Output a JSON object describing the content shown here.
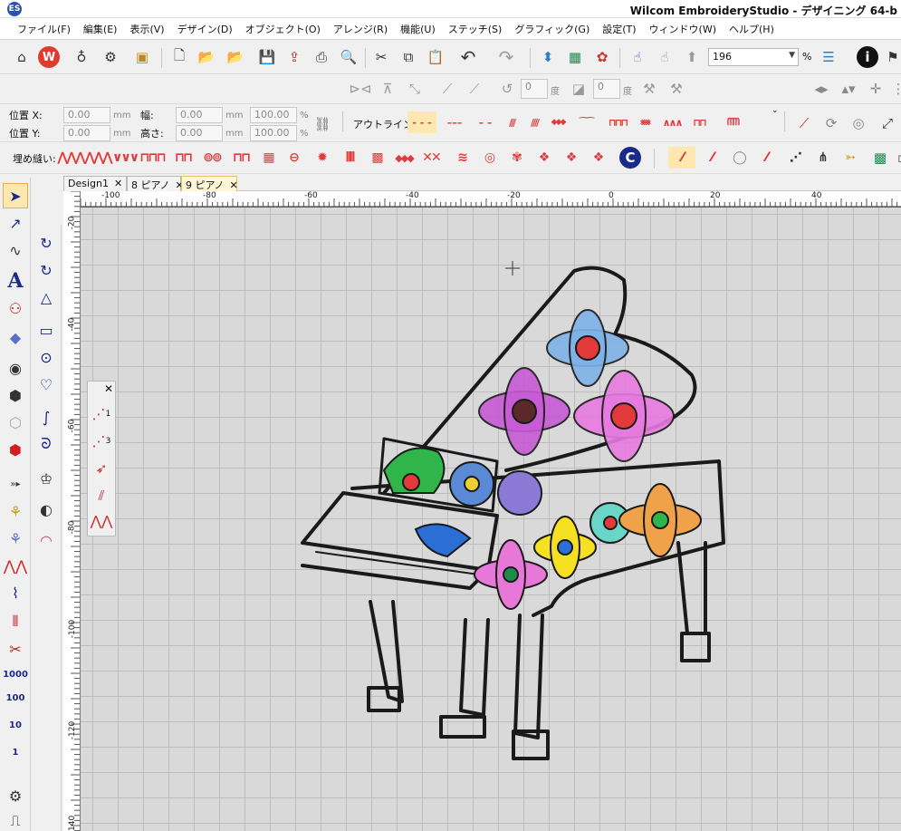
{
  "window": {
    "app_icon_label": "ES",
    "title": "Wilcom EmbroideryStudio - デザイニング 64-b"
  },
  "menu": [
    "ファイル(F)",
    "編集(E)",
    "表示(V)",
    "デザイン(D)",
    "オブジェクト(O)",
    "アレンジ(R)",
    "機能(U)",
    "ステッチ(S)",
    "グラフィック(G)",
    "設定(T)",
    "ウィンドウ(W)",
    "ヘルプ(H)"
  ],
  "toolbar": {
    "zoom_value": "196",
    "zoom_unit": "%",
    "redo_field_1": "0",
    "redo_field_2": "0",
    "unit_deg": "度"
  },
  "properties": {
    "pos_x_label": "位置 X:",
    "pos_y_label": "位置 Y:",
    "pos_x": "0.00",
    "pos_y": "0.00",
    "width_label": "幅:",
    "height_label": "高さ:",
    "width": "0.00",
    "height": "0.00",
    "scale_w": "100.00",
    "scale_h": "100.00",
    "unit_mm": "mm",
    "unit_pct": "%",
    "outline_label": "アウトライン:",
    "fill_label": "埋め縫い:"
  },
  "tabs": [
    {
      "label": "Design1",
      "active": false
    },
    {
      "label": "8 ピアノ",
      "active": false
    },
    {
      "label": "9 ピアノ",
      "active": true
    }
  ],
  "ruler_top": [
    "-100",
    "-80",
    "-60",
    "-40",
    "-20",
    "0",
    "20",
    "40"
  ],
  "ruler_left": [
    "-20",
    "-40",
    "-60",
    "-80",
    "-100",
    "-120",
    "-140"
  ],
  "stitch_lengths": [
    "1000",
    "100",
    "10",
    "1"
  ],
  "float_panel": {
    "close": "✕",
    "item1": "1",
    "item2": "3"
  },
  "colors": {
    "accent_red": "#e23a3a",
    "outline_black": "#1a1a1a",
    "canvas_bg": "#d9d9d9",
    "active_tab": "#fff6d8"
  }
}
